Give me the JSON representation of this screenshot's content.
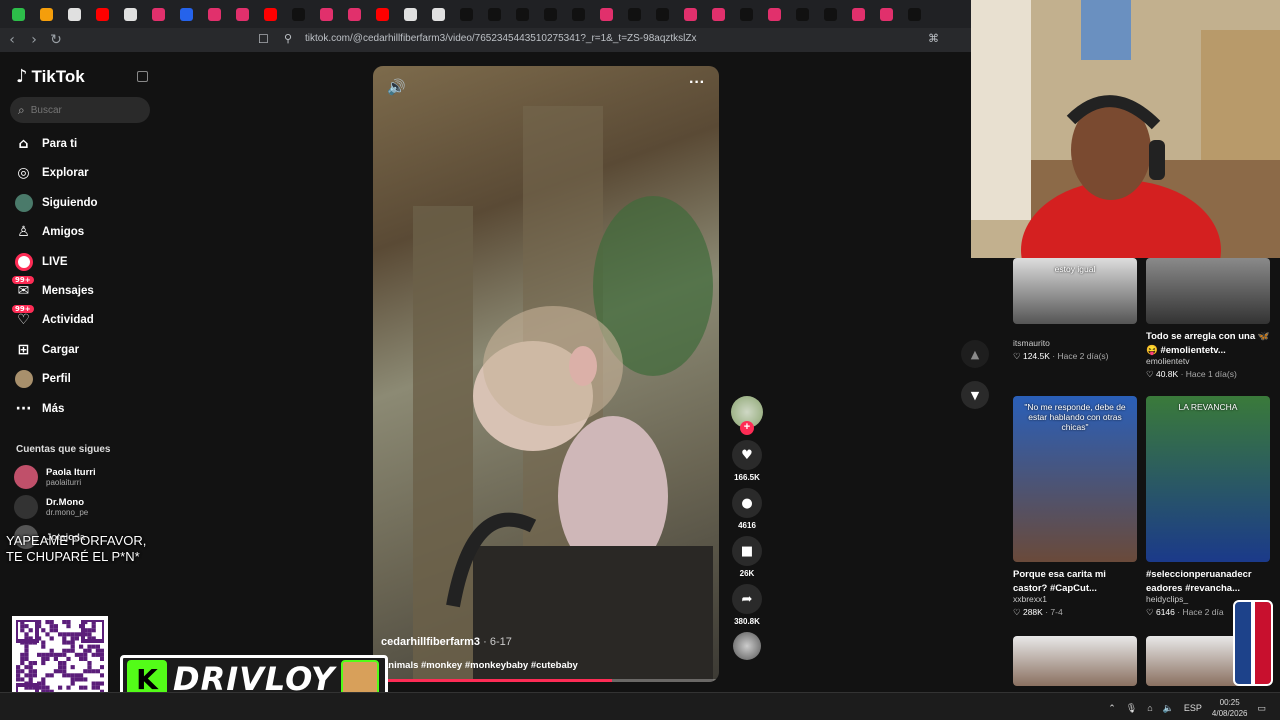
{
  "browser": {
    "url": "tiktok.com/@cedarhillfiberfarm3/video/7652345443510275341?_r=1&_t=ZS-98aqztkslZx",
    "tab_colors": [
      "#2dbe4a",
      "#f59e0b",
      "#e0e0e0",
      "#ff0000",
      "#e0e0e0",
      "#e1306c",
      "#2563eb",
      "#e1306c",
      "#e1306c",
      "#ff0000",
      "#111111",
      "#e1306c",
      "#e1306c",
      "#ff0000",
      "#e0e0e0",
      "#e0e0e0",
      "#111111",
      "#111111",
      "#111111",
      "#111111",
      "#111111",
      "#e1306c",
      "#111111",
      "#111111",
      "#e1306c",
      "#e1306c",
      "#111111",
      "#e1306c",
      "#111111",
      "#111111",
      "#e1306c",
      "#e1306c",
      "#111111"
    ]
  },
  "sidebar": {
    "logo": "TikTok",
    "search_placeholder": "Buscar",
    "nav": [
      {
        "label": "Para ti",
        "icon": "home-icon"
      },
      {
        "label": "Explorar",
        "icon": "compass-icon"
      },
      {
        "label": "Siguiendo",
        "icon": "following-avatar-icon"
      },
      {
        "label": "Amigos",
        "icon": "friends-icon"
      },
      {
        "label": "LIVE",
        "icon": "live-icon"
      },
      {
        "label": "Mensajes",
        "icon": "messages-icon",
        "badge": "99+"
      },
      {
        "label": "Actividad",
        "icon": "activity-icon",
        "badge": "99+"
      },
      {
        "label": "Cargar",
        "icon": "upload-icon"
      },
      {
        "label": "Perfil",
        "icon": "profile-icon"
      },
      {
        "label": "Más",
        "icon": "more-icon"
      }
    ],
    "following_title": "Cuentas que sigues",
    "following": [
      {
        "name": "Paola Iturri",
        "handle": "paolaiturri"
      },
      {
        "name": "Dr.Mono",
        "handle": "dr.mono_pe"
      },
      {
        "name": "Jotajoda",
        "handle": ""
      }
    ]
  },
  "video": {
    "username": "cedarhillfiberfarm3",
    "date": "· 6-17",
    "caption": "animals #monkey #monkeybaby #cutebaby",
    "progress": 0.69
  },
  "actions": {
    "likes": "166.5K",
    "comments": "4616",
    "saves": "26K",
    "shares": "380.8K"
  },
  "related": [
    {
      "title": "",
      "author": "itsmaurito",
      "likes": "124.5K",
      "time": "Hace 2 día(s)",
      "thumb_text": "estoy igual"
    },
    {
      "title": "Todo se arregla con una 🦋😝 #emolientetv...",
      "author": "emolientetv",
      "likes": "40.8K",
      "time": "Hace 1 día(s)",
      "thumb_text": ""
    },
    {
      "title": "Porque esa carita mi castor? #CapCut...",
      "author": "xxbrexx1",
      "likes": "288K",
      "time": "7-4",
      "thumb_text": "\"No me responde, debe de estar hablando con otras chicas\""
    },
    {
      "title": "#seleccionperuanadecr eadores #revancha...",
      "author": "heidyclips_",
      "likes": "6146",
      "time": "Hace 2 día",
      "thumb_text": "LA REVANCHA"
    }
  ],
  "overlay": {
    "text_line1": "YAPEAME PORFAVOR,",
    "text_line2": "TE CHUPARÉ  EL P*N*",
    "brand": "DRIVLOY",
    "brand_k": "K"
  },
  "taskbar": {
    "lang": "ESP",
    "time": "00:25",
    "date": "4/08/2026"
  }
}
